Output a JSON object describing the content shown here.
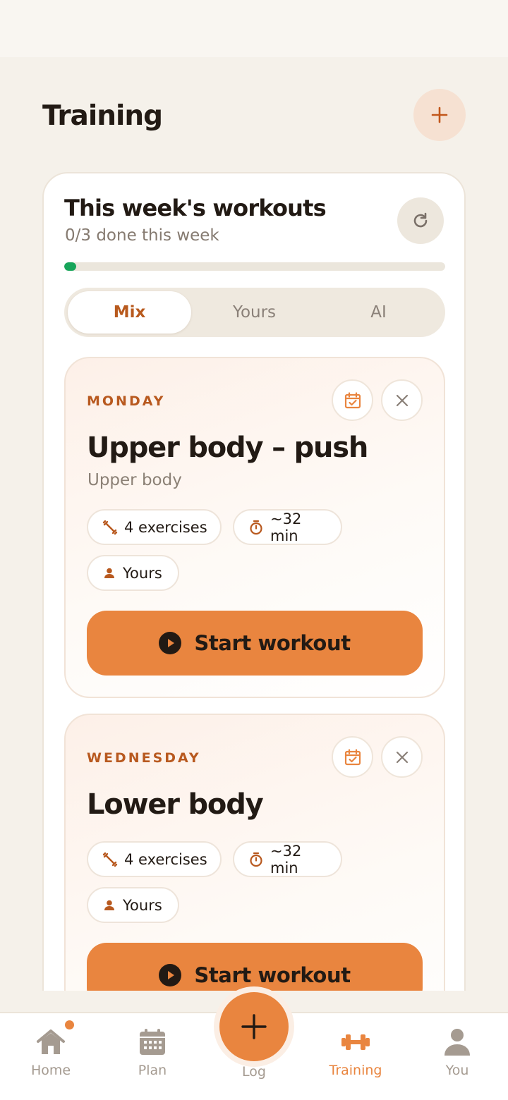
{
  "header": {
    "title": "Training",
    "add_icon": "plus-icon"
  },
  "weekly": {
    "title": "This week's workouts",
    "subtitle": "0/3 done this week",
    "progress": 0,
    "refresh_icon": "refresh-icon"
  },
  "tabs": [
    {
      "label": "Mix",
      "active": true
    },
    {
      "label": "Yours",
      "active": false
    },
    {
      "label": "AI",
      "active": false
    }
  ],
  "workouts": [
    {
      "day": "MONDAY",
      "title": "Upper body – push",
      "subtitle": "Upper body",
      "exercises": "4 exercises",
      "duration": "~32 min",
      "source": "Yours",
      "start_label": "Start workout"
    },
    {
      "day": "WEDNESDAY",
      "title": "Lower body",
      "exercises": "4 exercises",
      "duration": "~32 min",
      "source": "Yours",
      "start_label": "Start workout"
    }
  ],
  "nav": {
    "home": "Home",
    "plan": "Plan",
    "log": "Log",
    "training": "Training",
    "you": "You",
    "active": "training"
  },
  "colors": {
    "accent": "#e9853f",
    "accent_dark": "#b8591f",
    "progress": "#17a55a",
    "background": "#f5f1ea"
  }
}
